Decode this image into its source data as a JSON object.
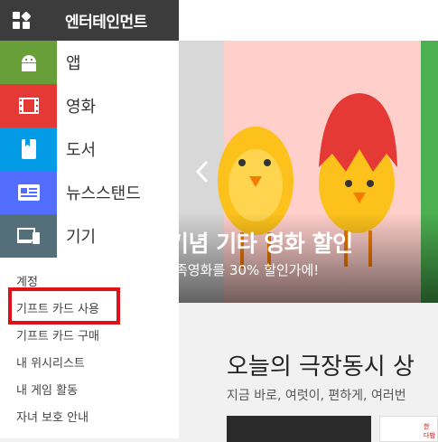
{
  "header": {
    "title": "엔터테인먼트"
  },
  "menu": {
    "items": [
      {
        "label": "앱",
        "color": "#689f38",
        "icon": "android-icon"
      },
      {
        "label": "영화",
        "color": "#e53935",
        "icon": "film-icon"
      },
      {
        "label": "도서",
        "color": "#039be5",
        "icon": "book-icon"
      },
      {
        "label": "뉴스스탠드",
        "color": "#536dfe",
        "icon": "newsstand-icon"
      },
      {
        "label": "기기",
        "color": "#546e7a",
        "icon": "devices-icon"
      }
    ]
  },
  "account": {
    "items": [
      "계정",
      "기프트 카드 사용",
      "기프트 카드 구매",
      "내 위시리스트",
      "내 게임 활동",
      "자녀 보호 안내"
    ]
  },
  "banner": {
    "headline": "기념 기타 영화 할인",
    "sub": "족영화를 30% 할인가에!"
  },
  "section": {
    "title": "오늘의 극장동시 상",
    "sub": "지금 바로, 여럿이, 편하게, 여러번"
  },
  "thumb2": {
    "text": "한 다밤"
  }
}
